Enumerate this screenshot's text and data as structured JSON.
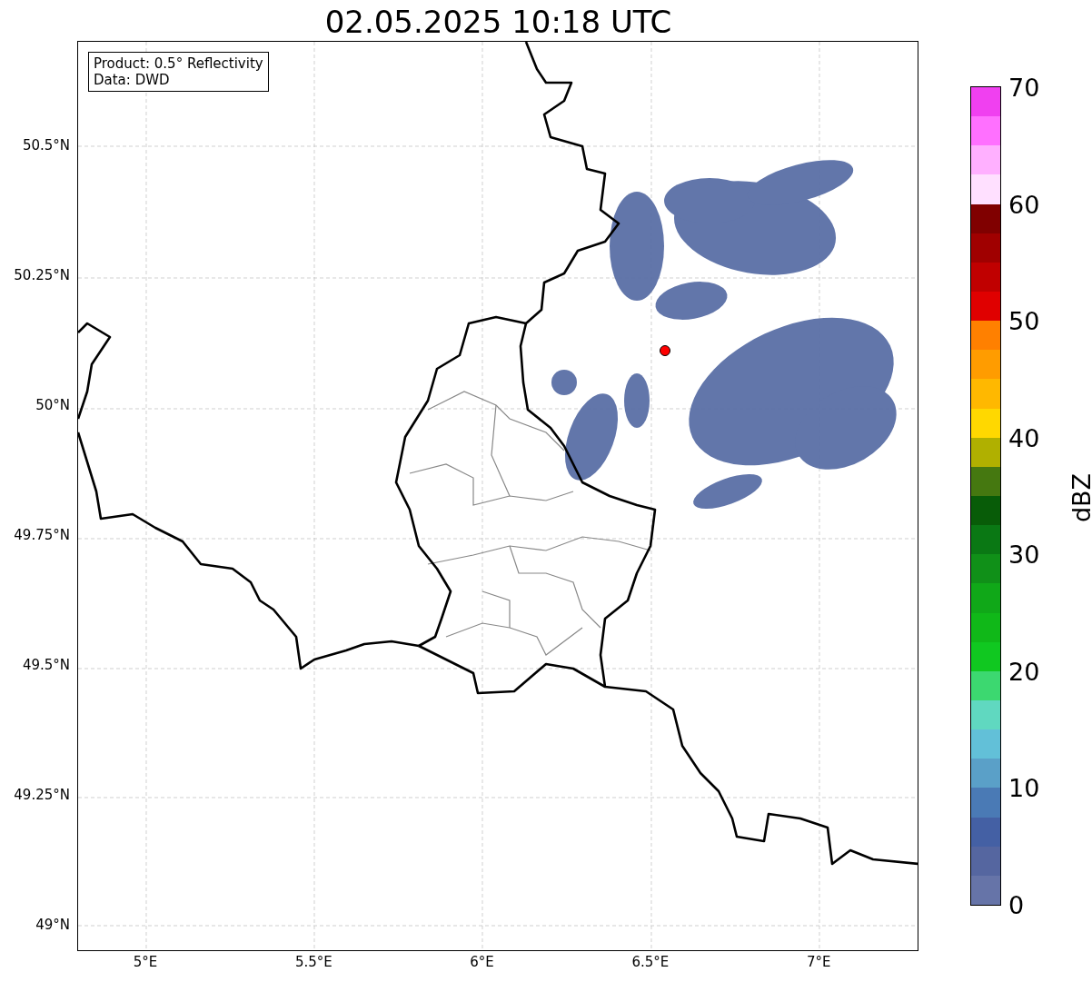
{
  "title": "02.05.2025 10:18 UTC",
  "info_box": {
    "lines": [
      "Product: 0.5° Reflectivity",
      "Data: DWD"
    ]
  },
  "map": {
    "y_ticks": [
      "50.5°N",
      "50.25°N",
      "50°N",
      "49.75°N",
      "49.5°N",
      "49.25°N",
      "49°N"
    ],
    "x_ticks": [
      "5°E",
      "5.5°E",
      "6°E",
      "6.5°E",
      "7°E"
    ]
  },
  "colorbar": {
    "label": "dBZ",
    "ticks": [
      "70",
      "60",
      "50",
      "40",
      "30",
      "20",
      "10",
      "0"
    ],
    "bands": [
      {
        "color": "#6674a8"
      },
      {
        "color": "#5566a0"
      },
      {
        "color": "#4460a4"
      },
      {
        "color": "#4a7ab5"
      },
      {
        "color": "#5aa0c8"
      },
      {
        "color": "#62c0d8"
      },
      {
        "color": "#60d8c0"
      },
      {
        "color": "#3cd870"
      },
      {
        "color": "#10c820"
      },
      {
        "color": "#10b818"
      },
      {
        "color": "#10a818"
      },
      {
        "color": "#109018"
      },
      {
        "color": "#0a7814"
      },
      {
        "color": "#085c08"
      },
      {
        "color": "#457810"
      },
      {
        "color": "#b0b000"
      },
      {
        "color": "#ffd800"
      },
      {
        "color": "#ffb800"
      },
      {
        "color": "#ff9c00"
      },
      {
        "color": "#ff8000"
      },
      {
        "color": "#e00000"
      },
      {
        "color": "#c00000"
      },
      {
        "color": "#a00000"
      },
      {
        "color": "#800000"
      },
      {
        "color": "#ffe0ff"
      },
      {
        "color": "#ffb0ff"
      },
      {
        "color": "#ff70ff"
      },
      {
        "color": "#f040f0"
      }
    ]
  }
}
